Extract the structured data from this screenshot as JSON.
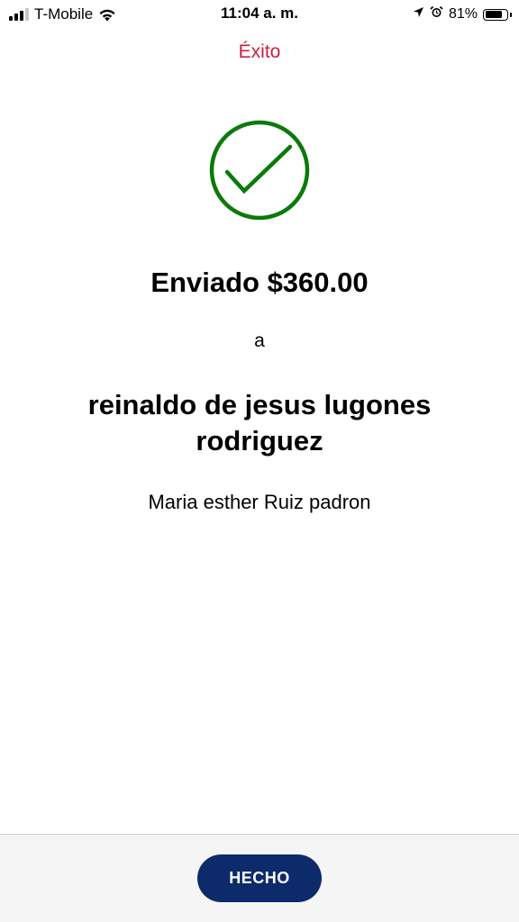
{
  "status_bar": {
    "carrier": "T-Mobile",
    "time": "11:04 a. m.",
    "battery_percent": "81%",
    "battery_level": 0.81,
    "icons": [
      "signal-icon",
      "wifi-icon",
      "location-icon",
      "alarm-icon",
      "battery-icon"
    ]
  },
  "header": {
    "title": "Éxito"
  },
  "confirmation": {
    "icon": "check-circle-icon",
    "amount_text": "Enviado $360.00",
    "connector": "a",
    "recipient": "reinaldo de jesus lugones rodriguez",
    "sender": "Maria esther Ruiz padron"
  },
  "footer": {
    "done_label": "HECHO"
  },
  "colors": {
    "title": "#cc1f3e",
    "success_green": "#0a7a0a",
    "button_bg": "#0d2a6b",
    "footer_bg": "#f5f5f5"
  }
}
